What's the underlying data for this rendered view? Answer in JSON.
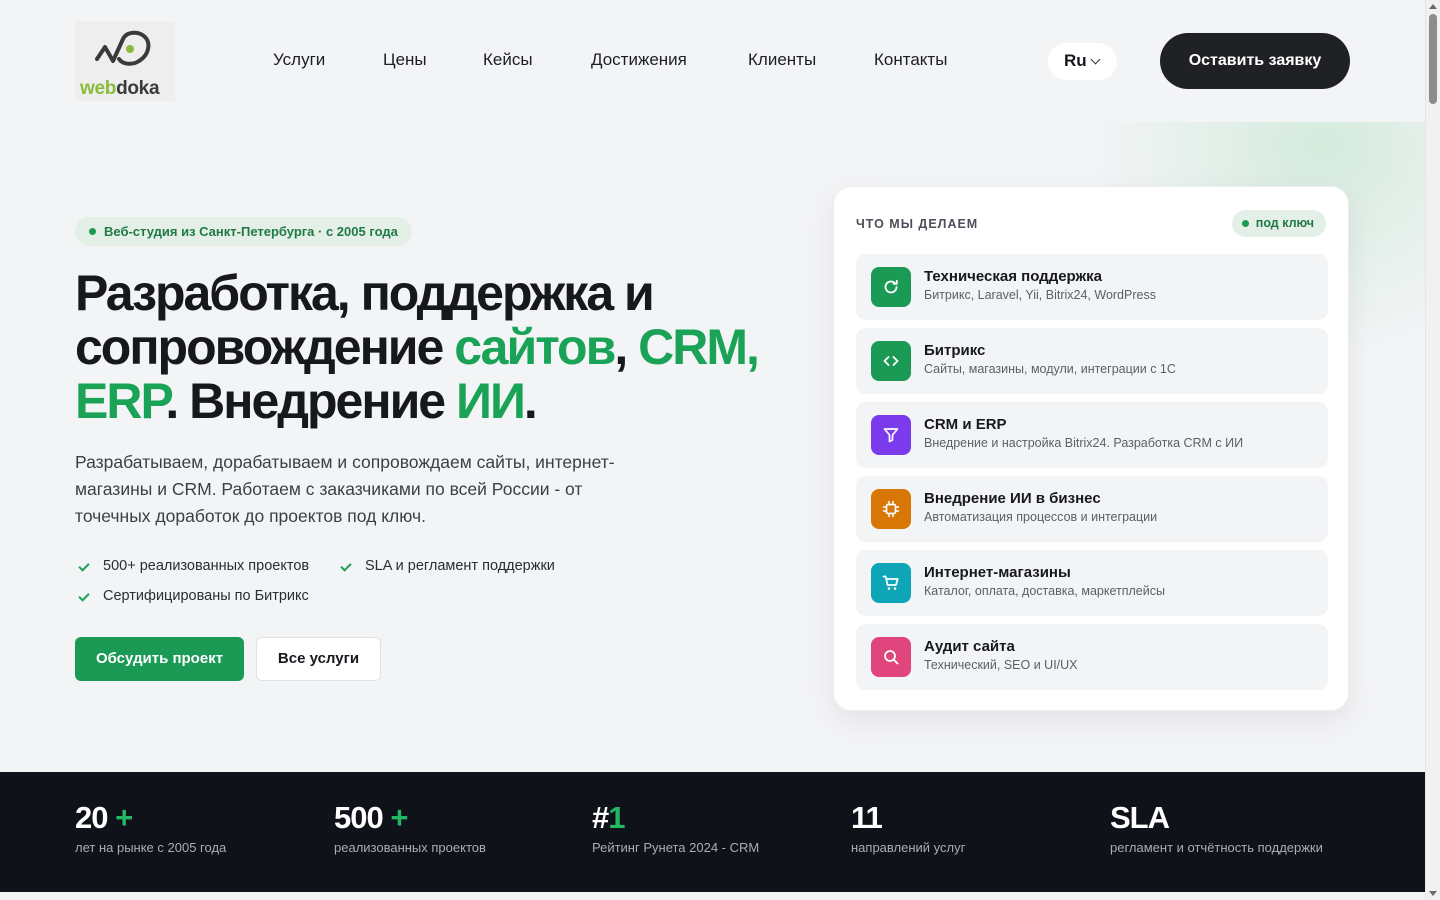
{
  "header": {
    "logo": {
      "web": "web",
      "doka": "doka"
    },
    "nav": [
      "Услуги",
      "Цены",
      "Кейсы",
      "Достижения",
      "Клиенты",
      "Контакты"
    ],
    "lang": "Ru",
    "cta": "Оставить заявку"
  },
  "hero": {
    "badge": "Веб-студия из Санкт-Петербурга · с 2005 года",
    "title": {
      "p1": "Разработка, поддержка и сопровождение ",
      "g1": "сайтов",
      "p2": ", ",
      "g2": "CRM, ERP",
      "p3": ". Внедрение ",
      "g3": "ИИ",
      "p4": "."
    },
    "description": "Разрабатываем, дорабатываем и сопровождаем сайты, интернет-магазины и CRM. Работаем с заказчиками по всей России - от точечных доработок до проектов под ключ.",
    "features": [
      "500+ реализованных проектов",
      "SLA и регламент поддержки",
      "Сертифицированы по Битрикс"
    ],
    "primary_button": "Обсудить проект",
    "secondary_button": "Все услуги"
  },
  "services_card": {
    "heading": "ЧТО МЫ ДЕЛАЕМ",
    "pill": "под ключ",
    "items": [
      {
        "title": "Техническая поддержка",
        "subtitle": "Битрикс, Laravel, Yii, Bitrix24, WordPress",
        "icon": "refresh-icon",
        "color": "#1a9a55"
      },
      {
        "title": "Битрикс",
        "subtitle": "Сайты, магазины, модули, интеграции с 1С",
        "icon": "code-icon",
        "color": "#1a9a55"
      },
      {
        "title": "CRM и ERP",
        "subtitle": "Внедрение и настройка Bitrix24. Разработка CRM с ИИ",
        "icon": "filter-icon",
        "color": "#7c3aed"
      },
      {
        "title": "Внедрение ИИ в бизнес",
        "subtitle": "Автоматизация процессов и интеграции",
        "icon": "chip-icon",
        "color": "#d97706"
      },
      {
        "title": "Интернет-магазины",
        "subtitle": "Каталог, оплата, доставка, маркетплейсы",
        "icon": "cart-icon",
        "color": "#0ea5b7"
      },
      {
        "title": "Аудит сайта",
        "subtitle": "Технический, SEO и UI/UX",
        "icon": "search-icon",
        "color": "#e0457b"
      }
    ]
  },
  "stats": [
    {
      "value": "20",
      "accent": " +",
      "label": "лет на рынке с 2005 года"
    },
    {
      "value": "500",
      "accent": " +",
      "label": "реализованных проектов"
    },
    {
      "value": "#",
      "accent": "1",
      "label": "Рейтинг Рунета 2024 - CRM"
    },
    {
      "value": "11",
      "accent": "",
      "label": "направлений услуг"
    },
    {
      "value": "SLA",
      "accent": "",
      "label": "регламент и отчётность поддержки"
    }
  ]
}
